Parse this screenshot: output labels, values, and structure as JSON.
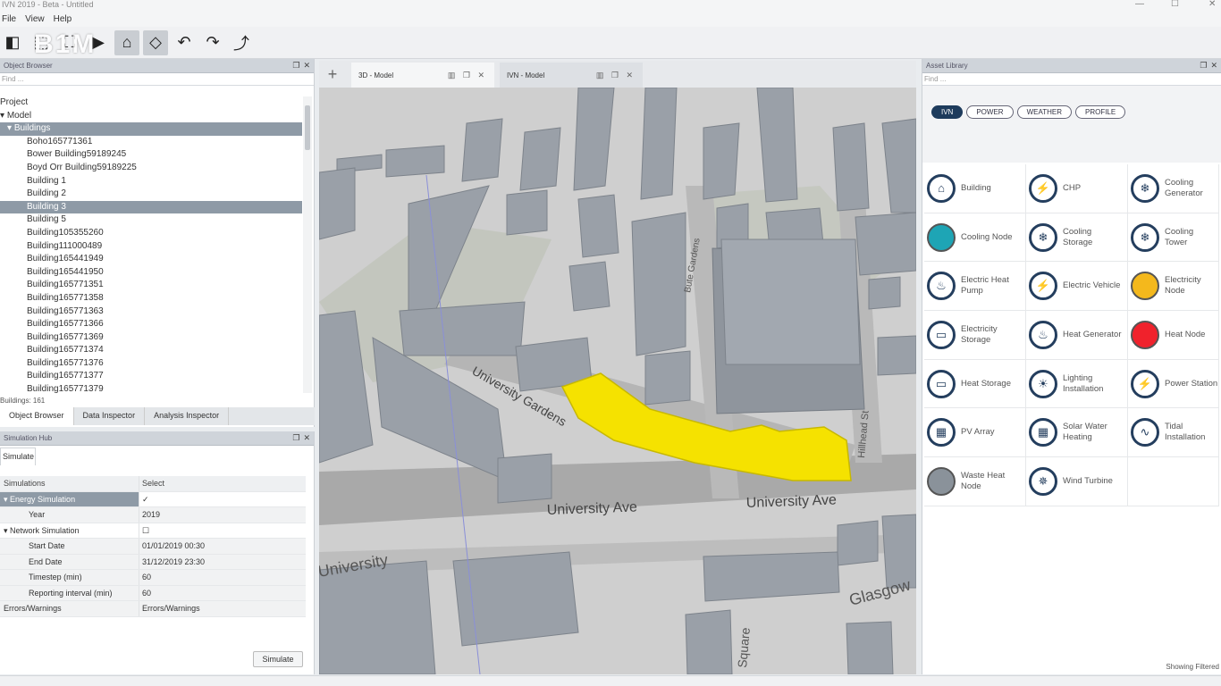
{
  "window": {
    "title": "IVN 2019 - Beta - Untitled"
  },
  "menu": [
    "File",
    "View",
    "Help"
  ],
  "toolbar": {
    "logo": "B1M"
  },
  "object_browser": {
    "title": "Object Browser",
    "search_placeholder": "Find ...",
    "tree": [
      {
        "label": "Project",
        "indent": 0,
        "selected": false
      },
      {
        "label": "Model",
        "indent": 1,
        "selected": false
      },
      {
        "label": "Buildings",
        "indent": 2,
        "selected": true
      },
      {
        "label": "Boho165771361",
        "indent": 3,
        "selected": false
      },
      {
        "label": "Bower Building59189245",
        "indent": 3,
        "selected": false
      },
      {
        "label": "Boyd Orr Building59189225",
        "indent": 3,
        "selected": false
      },
      {
        "label": "Building 1",
        "indent": 3,
        "selected": false
      },
      {
        "label": "Building 2",
        "indent": 3,
        "selected": false
      },
      {
        "label": "Building 3",
        "indent": 3,
        "selected": true
      },
      {
        "label": "Building 5",
        "indent": 3,
        "selected": false
      },
      {
        "label": "Building105355260",
        "indent": 3,
        "selected": false
      },
      {
        "label": "Building111000489",
        "indent": 3,
        "selected": false
      },
      {
        "label": "Building165441949",
        "indent": 3,
        "selected": false
      },
      {
        "label": "Building165441950",
        "indent": 3,
        "selected": false
      },
      {
        "label": "Building165771351",
        "indent": 3,
        "selected": false
      },
      {
        "label": "Building165771358",
        "indent": 3,
        "selected": false
      },
      {
        "label": "Building165771363",
        "indent": 3,
        "selected": false
      },
      {
        "label": "Building165771366",
        "indent": 3,
        "selected": false
      },
      {
        "label": "Building165771369",
        "indent": 3,
        "selected": false
      },
      {
        "label": "Building165771374",
        "indent": 3,
        "selected": false
      },
      {
        "label": "Building165771376",
        "indent": 3,
        "selected": false
      },
      {
        "label": "Building165771377",
        "indent": 3,
        "selected": false
      },
      {
        "label": "Building165771379",
        "indent": 3,
        "selected": false
      }
    ],
    "count_label": "Buildings: 161",
    "tabs": [
      "Object Browser",
      "Data Inspector",
      "Analysis Inspector"
    ]
  },
  "simulation_hub": {
    "title": "Simulation Hub",
    "tab": "Simulate",
    "headers": [
      "Simulations",
      "Select"
    ],
    "rows": [
      {
        "name": "Energy Simulation",
        "value": "✓",
        "indent": 1,
        "selected": true,
        "grey": false
      },
      {
        "name": "Year",
        "value": "2019",
        "indent": 2,
        "selected": false,
        "grey": true
      },
      {
        "name": "Network Simulation",
        "value": "☐",
        "indent": 1,
        "selected": false,
        "grey": false
      },
      {
        "name": "Start Date",
        "value": "01/01/2019 00:30",
        "indent": 2,
        "selected": false,
        "grey": true
      },
      {
        "name": "End Date",
        "value": "31/12/2019 23:30",
        "indent": 2,
        "selected": false,
        "grey": true
      },
      {
        "name": "Timestep (min)",
        "value": "60",
        "indent": 2,
        "selected": false,
        "grey": true
      },
      {
        "name": "Reporting interval (min)",
        "value": "60",
        "indent": 2,
        "selected": false,
        "grey": true
      },
      {
        "name": "Errors/Warnings",
        "value": "Errors/Warnings",
        "indent": 1,
        "selected": false,
        "grey": true
      }
    ],
    "simulate_button": "Simulate"
  },
  "viewport": {
    "tabs": [
      {
        "label": "3D - Model",
        "active": true
      },
      {
        "label": "IVN - Model",
        "active": false
      }
    ],
    "map_labels": [
      "University Gardens",
      "University Ave",
      "University Ave",
      "Bute Gardens",
      "Hillhead St",
      "Glasgow",
      "University",
      "Square"
    ]
  },
  "asset_library": {
    "title": "Asset Library",
    "search_placeholder": "Find ...",
    "filters": [
      {
        "label": "IVN",
        "active": true
      },
      {
        "label": "POWER",
        "active": false
      },
      {
        "label": "WEATHER",
        "active": false
      },
      {
        "label": "PROFILE",
        "active": false
      }
    ],
    "assets": [
      {
        "label": "Building",
        "icon": "building-icon",
        "glyph": "⌂",
        "color": ""
      },
      {
        "label": "CHP",
        "icon": "chp-icon",
        "glyph": "⚡",
        "color": ""
      },
      {
        "label": "Cooling Generator",
        "icon": "cooling-generator-icon",
        "glyph": "❄",
        "color": ""
      },
      {
        "label": "Cooling Node",
        "icon": "cooling-node-icon",
        "glyph": "",
        "color": "#1ea5b5"
      },
      {
        "label": "Cooling Storage",
        "icon": "cooling-storage-icon",
        "glyph": "❄",
        "color": ""
      },
      {
        "label": "Cooling Tower",
        "icon": "cooling-tower-icon",
        "glyph": "❄",
        "color": ""
      },
      {
        "label": "Electric Heat Pump",
        "icon": "heat-pump-icon",
        "glyph": "♨",
        "color": ""
      },
      {
        "label": "Electric Vehicle",
        "icon": "electric-vehicle-icon",
        "glyph": "⚡",
        "color": ""
      },
      {
        "label": "Electricity Node",
        "icon": "electricity-node-icon",
        "glyph": "",
        "color": "#f4b81c"
      },
      {
        "label": "Electricity Storage",
        "icon": "electricity-storage-icon",
        "glyph": "▭",
        "color": ""
      },
      {
        "label": "Heat Generator",
        "icon": "heat-generator-icon",
        "glyph": "♨",
        "color": ""
      },
      {
        "label": "Heat Node",
        "icon": "heat-node-icon",
        "glyph": "",
        "color": "#f0222c"
      },
      {
        "label": "Heat Storage",
        "icon": "heat-storage-icon",
        "glyph": "▭",
        "color": ""
      },
      {
        "label": "Lighting Installation",
        "icon": "lighting-icon",
        "glyph": "☀",
        "color": ""
      },
      {
        "label": "Power Station",
        "icon": "power-station-icon",
        "glyph": "⚡",
        "color": ""
      },
      {
        "label": "PV Array",
        "icon": "pv-array-icon",
        "glyph": "▦",
        "color": ""
      },
      {
        "label": "Solar Water Heating",
        "icon": "solar-water-icon",
        "glyph": "▦",
        "color": ""
      },
      {
        "label": "Tidal Installation",
        "icon": "tidal-icon",
        "glyph": "∿",
        "color": ""
      },
      {
        "label": "Waste Heat Node",
        "icon": "waste-heat-node-icon",
        "glyph": "",
        "color": "#8a929a"
      },
      {
        "label": "Wind Turbine",
        "icon": "wind-turbine-icon",
        "glyph": "✵",
        "color": ""
      }
    ],
    "showing_label": "Showing Filtered"
  },
  "colors": {
    "selected_building": "#f5e200",
    "panel_header": "#cfd4da",
    "selection": "#8e9aa6",
    "pill_active": "#1e3b5c"
  }
}
